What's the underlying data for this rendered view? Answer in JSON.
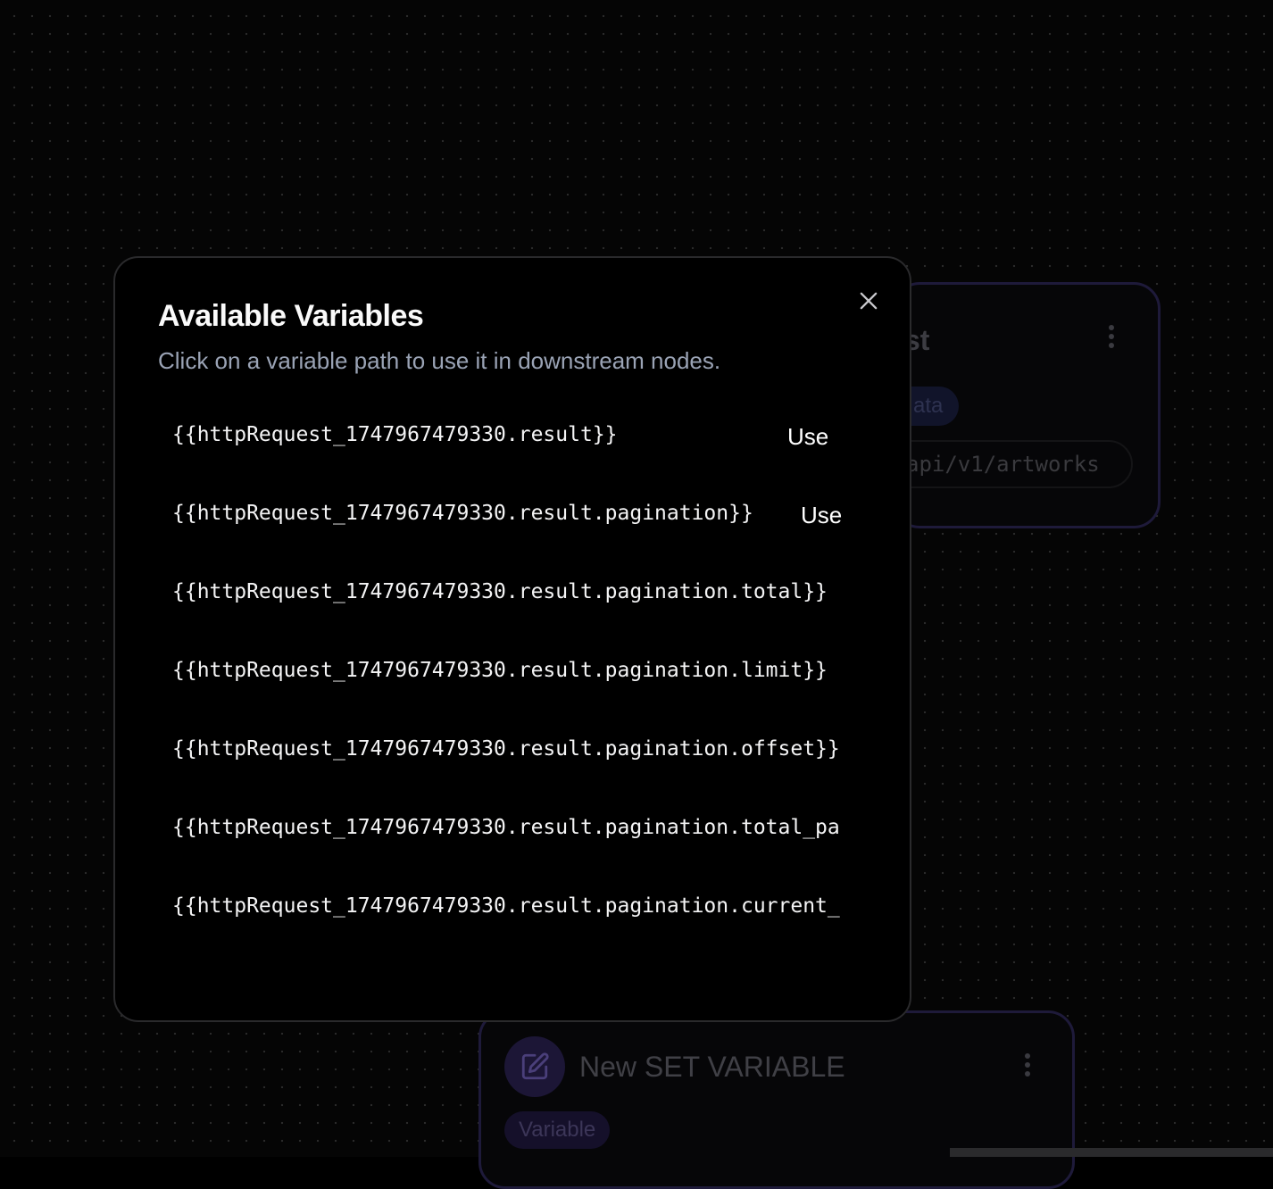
{
  "background_nodes": {
    "http_request": {
      "title": "st",
      "tag": "ata",
      "url": "api/v1/artworks"
    },
    "set_variable": {
      "title": "New SET VARIABLE",
      "tag": "Variable",
      "icon": "edit-icon"
    }
  },
  "modal": {
    "title": "Available Variables",
    "description": "Click on a variable path to use it in downstream nodes.",
    "close_icon": "close-icon",
    "use_label": "Use",
    "variables": [
      {
        "path": "{{httpRequest_1747967479330.result}}",
        "show_use": true
      },
      {
        "path": "{{httpRequest_1747967479330.result.pagination}}",
        "show_use": true
      },
      {
        "path": "{{httpRequest_1747967479330.result.pagination.total}}",
        "show_use": false
      },
      {
        "path": "{{httpRequest_1747967479330.result.pagination.limit}}",
        "show_use": false
      },
      {
        "path": "{{httpRequest_1747967479330.result.pagination.offset}}",
        "show_use": false
      },
      {
        "path": "{{httpRequest_1747967479330.result.pagination.total_pa",
        "show_use": false
      },
      {
        "path": "{{httpRequest_1747967479330.result.pagination.current_",
        "show_use": false
      }
    ]
  }
}
